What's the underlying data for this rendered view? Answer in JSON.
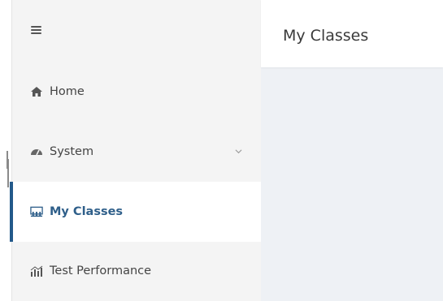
{
  "header": {
    "title": "My Classes"
  },
  "sidebar": {
    "menu_icon": "hamburger-icon",
    "items": [
      {
        "label": "Home",
        "icon": "home-icon"
      },
      {
        "label": "System",
        "icon": "gauge-icon",
        "expandable": true
      },
      {
        "label": "My Classes",
        "icon": "classroom-icon",
        "active": true
      },
      {
        "label": "Test Performance",
        "icon": "chart-icon"
      }
    ]
  },
  "colors": {
    "sidebar_bg": "#f4f4f4",
    "active_accent": "#23598a",
    "active_text": "#2f5f8a",
    "content_bg": "#eef1f5"
  }
}
